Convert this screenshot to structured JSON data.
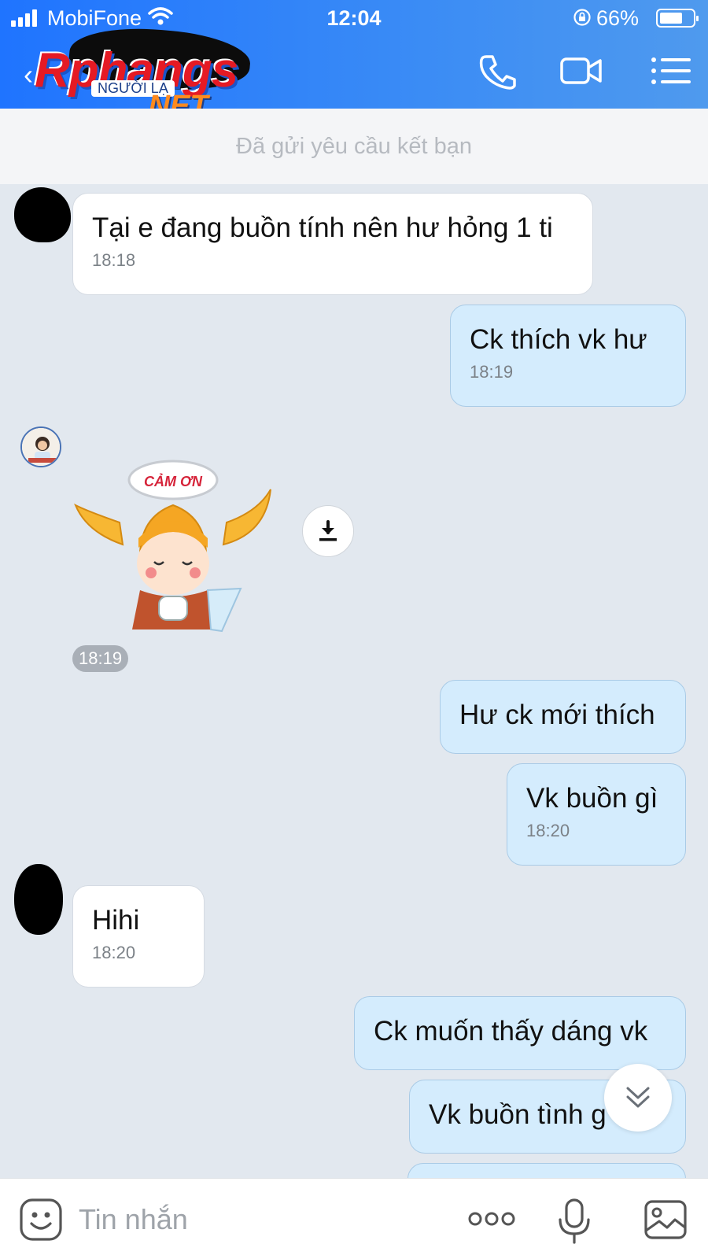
{
  "status_bar": {
    "carrier": "MobiFone",
    "time": "12:04",
    "battery_percent": "66%",
    "battery_level": 0.66
  },
  "header": {
    "logo_main": "Rphangs",
    "logo_sub": "NGƯỜI LẠ",
    "logo_tld": ".NET",
    "icons": [
      "back-icon",
      "phone-icon",
      "video-call-icon",
      "menu-icon"
    ],
    "accent_color": "#2f80f8"
  },
  "banner": {
    "text": "Đã gửi yêu cầu kết bạn"
  },
  "messages": [
    {
      "direction": "in",
      "text": "Tại e đang buồn tính nên hư hỏng 1 ti",
      "time": "18:18"
    },
    {
      "direction": "out",
      "text": "Ck thích vk hư",
      "time": "18:19"
    },
    {
      "direction": "in",
      "type": "sticker",
      "sticker_text": "CẢM ƠN",
      "time": "18:19"
    },
    {
      "direction": "out",
      "text": "Hư ck mới thích",
      "time": ""
    },
    {
      "direction": "out",
      "text": "Vk buồn gì",
      "time": "18:20"
    },
    {
      "direction": "in",
      "text": "Hihi",
      "time": "18:20"
    },
    {
      "direction": "out",
      "text": "Ck muốn thấy dáng vk",
      "time": ""
    },
    {
      "direction": "out",
      "text": "Vk buồn tình g",
      "time": ""
    }
  ],
  "input_bar": {
    "placeholder": "Tin nhắn",
    "icons": [
      "sticker-icon",
      "more-icon",
      "microphone-icon",
      "image-icon"
    ]
  },
  "colors": {
    "chat_background": "#e2e8ef",
    "outgoing_bubble": "#d4ecfd",
    "incoming_bubble": "#ffffff"
  }
}
